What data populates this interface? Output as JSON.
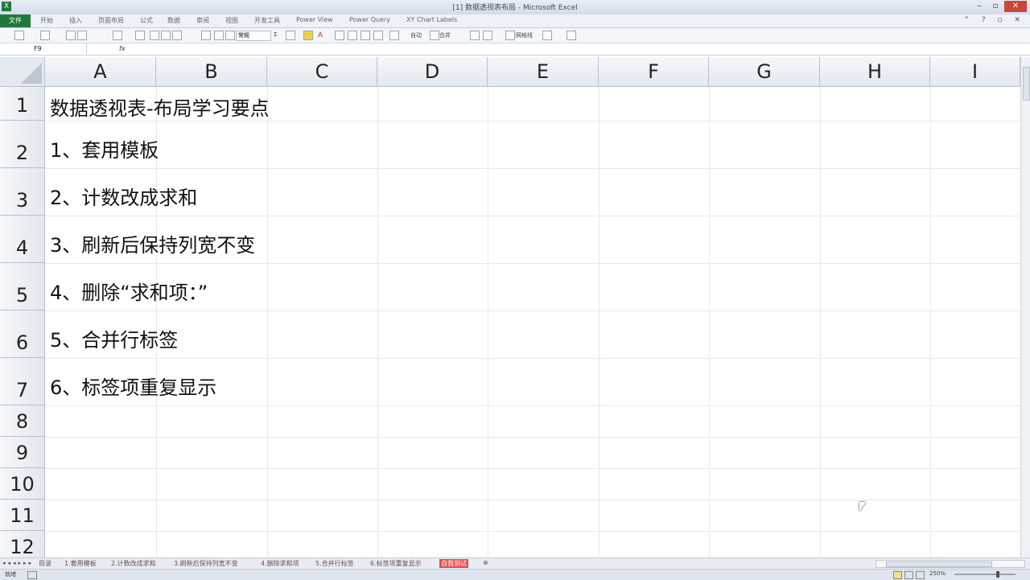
{
  "window": {
    "title": "[1] 数据透视表布局 - Microsoft Excel",
    "controls": [
      "–",
      "▫",
      "✕"
    ]
  },
  "ribbon": {
    "file_tab": "文件",
    "tabs": [
      "开始",
      "插入",
      "页面布局",
      "公式",
      "数据",
      "审阅",
      "视图",
      "开发工具",
      "Power View",
      "Power Query",
      "XY Chart Labels"
    ],
    "right_icons": "⌃ ? ▫ ✕"
  },
  "toolbar": {
    "number_format": "常规",
    "wrap_text": "自动",
    "merge_label": "合并",
    "grid_label": "网格线"
  },
  "formula_bar": {
    "name_box": "F9",
    "fx_label": "fx",
    "content": ""
  },
  "sheet": {
    "columns": [
      "A",
      "B",
      "C",
      "D",
      "E",
      "F",
      "G",
      "H",
      "I"
    ],
    "rows": [
      "1",
      "2",
      "3",
      "4",
      "5",
      "6",
      "7",
      "8",
      "9",
      "10",
      "11",
      "12"
    ],
    "cells": {
      "A1": "数据透视表-布局学习要点",
      "A2": "1、套用模板",
      "A3": "2、计数改成求和",
      "A4": "3、刷新后保持列宽不变",
      "A5": "4、删除“求和项：”",
      "A6": "5、合并行标签",
      "A7": "6、标签项重复显示"
    }
  },
  "sheet_tabs": {
    "nav": "◂◂◂▸▸▸",
    "tabs": [
      "目录",
      "1.套用模板",
      "2.计数改成求和",
      "3.刷新后保持列宽不变",
      "4.删除求和项",
      "5.合并行标签",
      "6.标签项重复显示",
      "自我测试"
    ],
    "active_index": 7
  },
  "status": {
    "ready": "就绪",
    "zoom": "250%"
  }
}
